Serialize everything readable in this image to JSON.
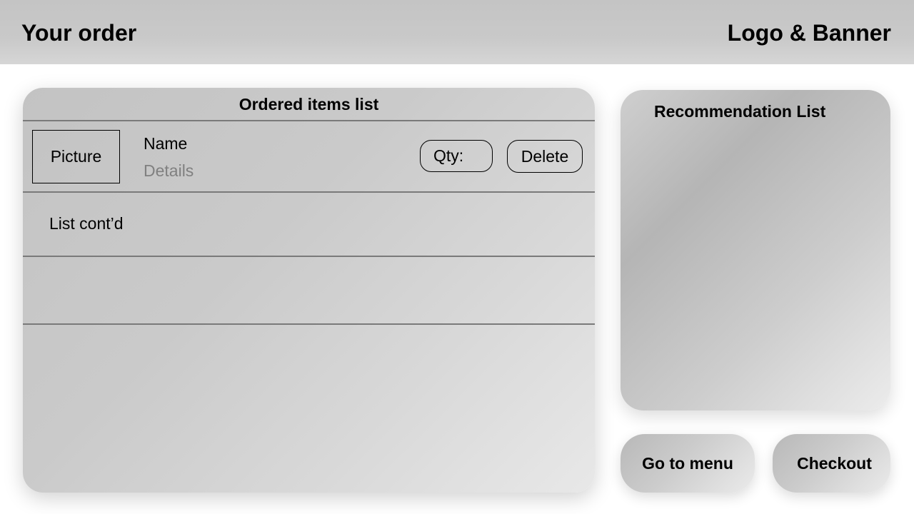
{
  "header": {
    "title": "Your order",
    "logo_text": "Logo & Banner"
  },
  "order_list": {
    "title": "Ordered items list",
    "items": [
      {
        "picture_label": "Picture",
        "name": "Name",
        "details": "Details",
        "qty_label": "Qty:",
        "delete_label": "Delete"
      }
    ],
    "continuation_text": "List cont’d"
  },
  "recommendations": {
    "title": "Recommendation List"
  },
  "actions": {
    "menu_label": "Go to menu",
    "checkout_label": "Checkout"
  },
  "colors": {
    "header_bg": "#c4c4c4",
    "panel_bg": "#cacaca",
    "divider": "#7a7a7a",
    "details_text": "#808080"
  }
}
